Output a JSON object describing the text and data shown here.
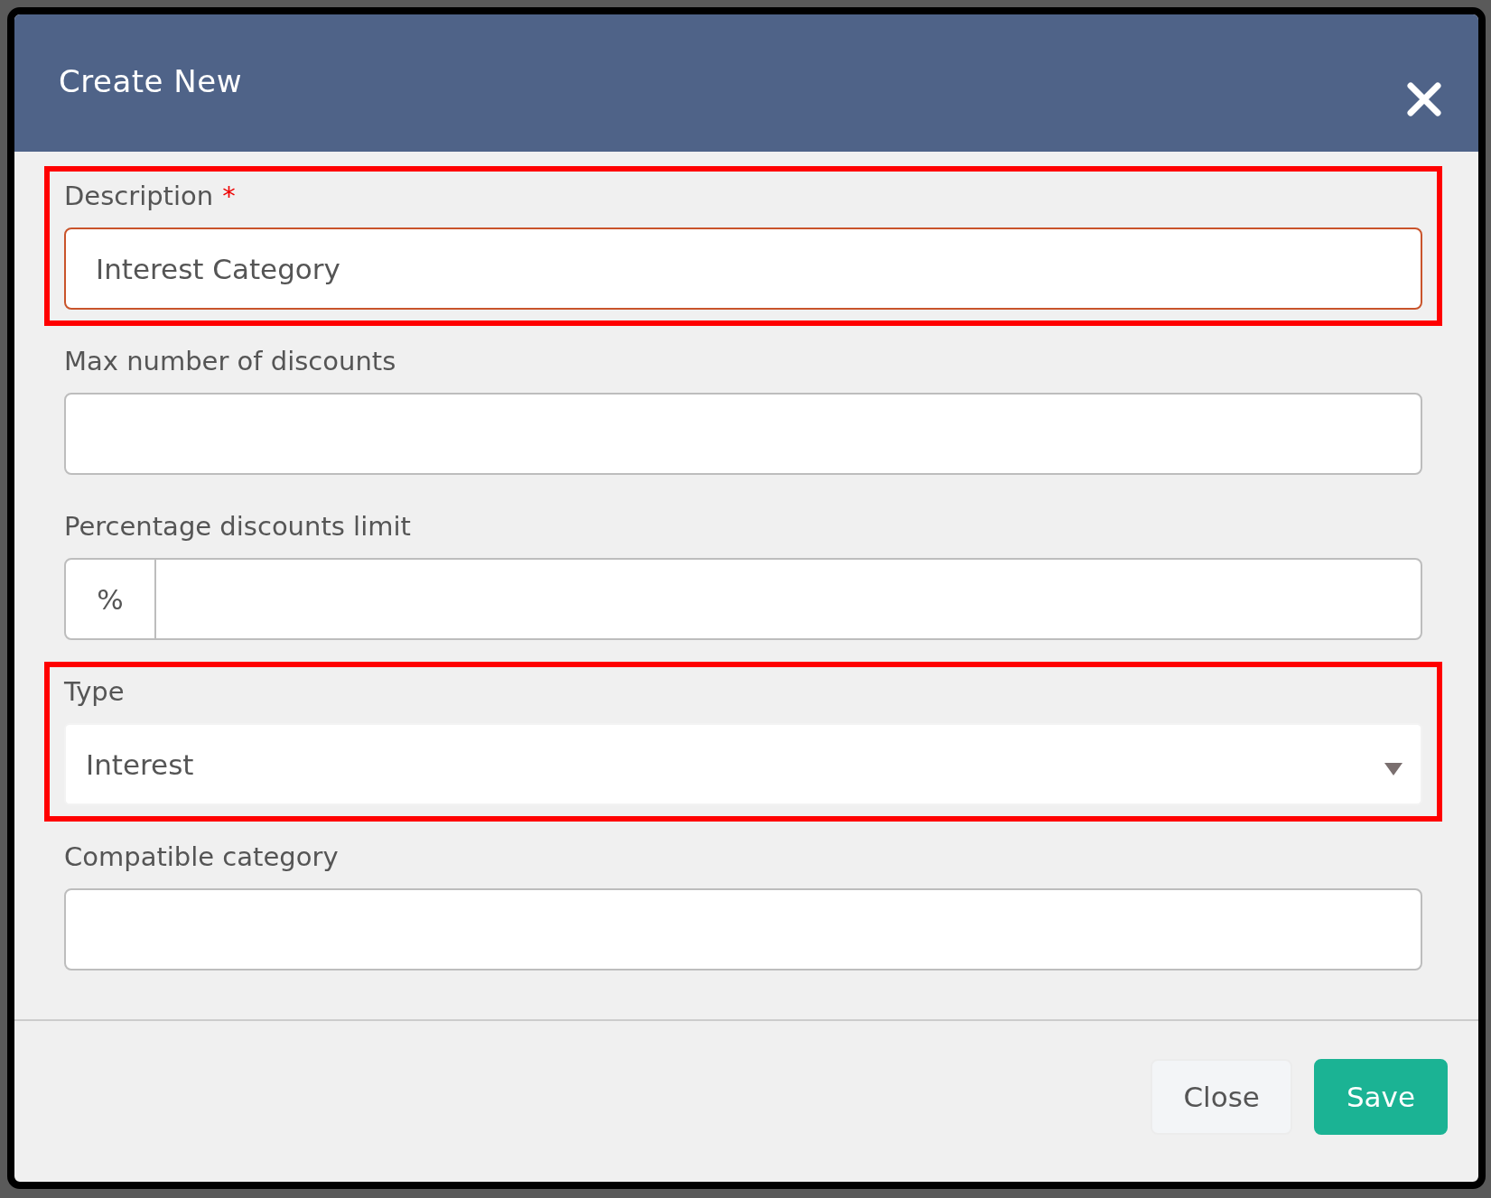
{
  "dialog": {
    "title": "Create New"
  },
  "fields": [
    {
      "kind": "text",
      "label": "Description",
      "required_mark": "*",
      "value": "Interest Category",
      "invalid": true,
      "highlighted": true
    },
    {
      "kind": "text",
      "label": "Max number of discounts",
      "invalid": false,
      "highlighted": false
    },
    {
      "kind": "addon",
      "label": "Percentage discounts limit",
      "addon": "%",
      "invalid": false,
      "highlighted": false
    },
    {
      "kind": "select",
      "label": "Type",
      "value": "Interest",
      "invalid": false,
      "highlighted": true
    },
    {
      "kind": "text",
      "label": "Compatible category",
      "invalid": false,
      "highlighted": false
    }
  ],
  "buttons": [
    {
      "label": "Close",
      "kind": "secondary"
    },
    {
      "label": "Save",
      "kind": "primary"
    }
  ]
}
